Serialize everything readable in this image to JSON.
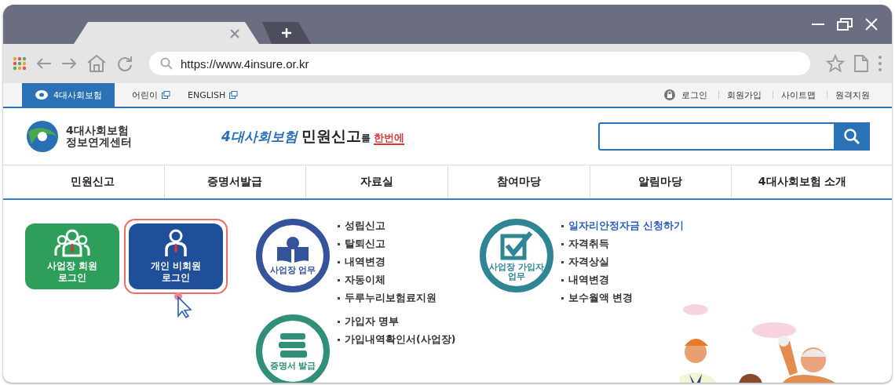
{
  "browser": {
    "url": "https://www.4insure.or.kr"
  },
  "utility_bar": {
    "brand_tab": {
      "label": "4대사회보험",
      "selected": true
    },
    "left_links": [
      {
        "label": "어린이"
      },
      {
        "label": "ENGLISH"
      }
    ],
    "right_links": [
      {
        "label": "로그인",
        "kind": "lock"
      },
      {
        "label": "회원가입",
        "kind": "plain"
      },
      {
        "label": "사이트맵",
        "kind": "plain"
      },
      {
        "label": "원격지원",
        "kind": "plain"
      }
    ]
  },
  "header": {
    "logo_lines": [
      "4대사회보험",
      "정보연계센터"
    ],
    "slogan": [
      {
        "text": "4대사회보험",
        "kind": "brand"
      },
      {
        "text": "민원신고",
        "kind": "bold"
      },
      {
        "text": "를",
        "kind": "small"
      },
      {
        "text": "한번에",
        "kind": "accent"
      }
    ]
  },
  "nav": [
    "민원신고",
    "증명서발급",
    "자료실",
    "참여마당",
    "알림마당",
    "4대사회보험 소개"
  ],
  "login_buttons": [
    {
      "lines": [
        "사업장 회원",
        "로그인"
      ],
      "color": "#2e9e5b",
      "kind": "group",
      "highlighted": false
    },
    {
      "lines": [
        "개인 비회원",
        "로그인"
      ],
      "color": "#1f4f99",
      "kind": "single",
      "highlighted": true
    }
  ],
  "services": [
    {
      "title": "사업장 업무",
      "color": "#34539a",
      "kind": "book",
      "items": [
        {
          "text": "성립신고",
          "highlight": false
        },
        {
          "text": "탈퇴신고",
          "highlight": false
        },
        {
          "text": "내역변경",
          "highlight": false
        },
        {
          "text": "자동이체",
          "highlight": false
        },
        {
          "text": "두루누리보험료지원",
          "highlight": false
        }
      ]
    },
    {
      "title": "사업장 가입자 업무",
      "color": "#2f8593",
      "kind": "check",
      "items": [
        {
          "text": "일자리안정자금 신청하기",
          "highlight": true
        },
        {
          "text": "자격취득",
          "highlight": false
        },
        {
          "text": "자격상실",
          "highlight": false
        },
        {
          "text": "내역변경",
          "highlight": false
        },
        {
          "text": "보수월액 변경",
          "highlight": false
        }
      ]
    },
    {
      "title": "증명서 발급",
      "color": "#2f8f78",
      "kind": "books",
      "items": [
        {
          "text": "가입자 명부",
          "highlight": false
        },
        {
          "text": "가입내역확인서(사업장)",
          "highlight": false
        }
      ]
    }
  ]
}
